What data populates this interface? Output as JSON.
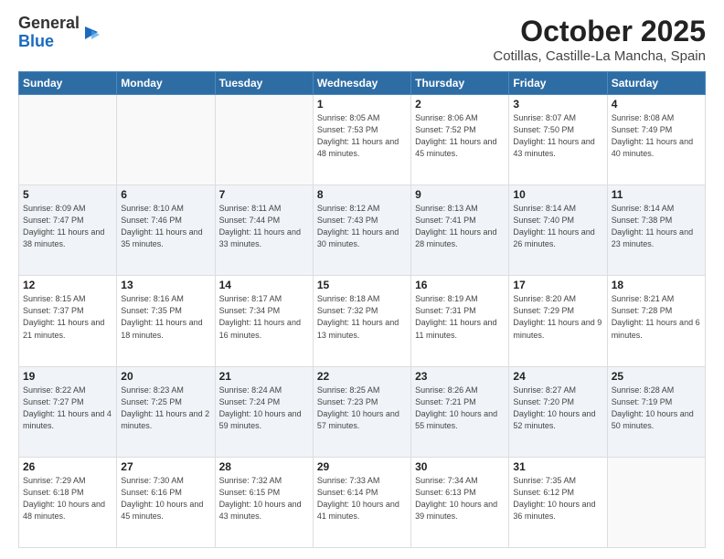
{
  "logo": {
    "general": "General",
    "blue": "Blue"
  },
  "title": "October 2025",
  "subtitle": "Cotillas, Castille-La Mancha, Spain",
  "days_of_week": [
    "Sunday",
    "Monday",
    "Tuesday",
    "Wednesday",
    "Thursday",
    "Friday",
    "Saturday"
  ],
  "weeks": [
    [
      {
        "day": "",
        "info": ""
      },
      {
        "day": "",
        "info": ""
      },
      {
        "day": "",
        "info": ""
      },
      {
        "day": "1",
        "info": "Sunrise: 8:05 AM\nSunset: 7:53 PM\nDaylight: 11 hours and 48 minutes."
      },
      {
        "day": "2",
        "info": "Sunrise: 8:06 AM\nSunset: 7:52 PM\nDaylight: 11 hours and 45 minutes."
      },
      {
        "day": "3",
        "info": "Sunrise: 8:07 AM\nSunset: 7:50 PM\nDaylight: 11 hours and 43 minutes."
      },
      {
        "day": "4",
        "info": "Sunrise: 8:08 AM\nSunset: 7:49 PM\nDaylight: 11 hours and 40 minutes."
      }
    ],
    [
      {
        "day": "5",
        "info": "Sunrise: 8:09 AM\nSunset: 7:47 PM\nDaylight: 11 hours and 38 minutes."
      },
      {
        "day": "6",
        "info": "Sunrise: 8:10 AM\nSunset: 7:46 PM\nDaylight: 11 hours and 35 minutes."
      },
      {
        "day": "7",
        "info": "Sunrise: 8:11 AM\nSunset: 7:44 PM\nDaylight: 11 hours and 33 minutes."
      },
      {
        "day": "8",
        "info": "Sunrise: 8:12 AM\nSunset: 7:43 PM\nDaylight: 11 hours and 30 minutes."
      },
      {
        "day": "9",
        "info": "Sunrise: 8:13 AM\nSunset: 7:41 PM\nDaylight: 11 hours and 28 minutes."
      },
      {
        "day": "10",
        "info": "Sunrise: 8:14 AM\nSunset: 7:40 PM\nDaylight: 11 hours and 26 minutes."
      },
      {
        "day": "11",
        "info": "Sunrise: 8:14 AM\nSunset: 7:38 PM\nDaylight: 11 hours and 23 minutes."
      }
    ],
    [
      {
        "day": "12",
        "info": "Sunrise: 8:15 AM\nSunset: 7:37 PM\nDaylight: 11 hours and 21 minutes."
      },
      {
        "day": "13",
        "info": "Sunrise: 8:16 AM\nSunset: 7:35 PM\nDaylight: 11 hours and 18 minutes."
      },
      {
        "day": "14",
        "info": "Sunrise: 8:17 AM\nSunset: 7:34 PM\nDaylight: 11 hours and 16 minutes."
      },
      {
        "day": "15",
        "info": "Sunrise: 8:18 AM\nSunset: 7:32 PM\nDaylight: 11 hours and 13 minutes."
      },
      {
        "day": "16",
        "info": "Sunrise: 8:19 AM\nSunset: 7:31 PM\nDaylight: 11 hours and 11 minutes."
      },
      {
        "day": "17",
        "info": "Sunrise: 8:20 AM\nSunset: 7:29 PM\nDaylight: 11 hours and 9 minutes."
      },
      {
        "day": "18",
        "info": "Sunrise: 8:21 AM\nSunset: 7:28 PM\nDaylight: 11 hours and 6 minutes."
      }
    ],
    [
      {
        "day": "19",
        "info": "Sunrise: 8:22 AM\nSunset: 7:27 PM\nDaylight: 11 hours and 4 minutes."
      },
      {
        "day": "20",
        "info": "Sunrise: 8:23 AM\nSunset: 7:25 PM\nDaylight: 11 hours and 2 minutes."
      },
      {
        "day": "21",
        "info": "Sunrise: 8:24 AM\nSunset: 7:24 PM\nDaylight: 10 hours and 59 minutes."
      },
      {
        "day": "22",
        "info": "Sunrise: 8:25 AM\nSunset: 7:23 PM\nDaylight: 10 hours and 57 minutes."
      },
      {
        "day": "23",
        "info": "Sunrise: 8:26 AM\nSunset: 7:21 PM\nDaylight: 10 hours and 55 minutes."
      },
      {
        "day": "24",
        "info": "Sunrise: 8:27 AM\nSunset: 7:20 PM\nDaylight: 10 hours and 52 minutes."
      },
      {
        "day": "25",
        "info": "Sunrise: 8:28 AM\nSunset: 7:19 PM\nDaylight: 10 hours and 50 minutes."
      }
    ],
    [
      {
        "day": "26",
        "info": "Sunrise: 7:29 AM\nSunset: 6:18 PM\nDaylight: 10 hours and 48 minutes."
      },
      {
        "day": "27",
        "info": "Sunrise: 7:30 AM\nSunset: 6:16 PM\nDaylight: 10 hours and 45 minutes."
      },
      {
        "day": "28",
        "info": "Sunrise: 7:32 AM\nSunset: 6:15 PM\nDaylight: 10 hours and 43 minutes."
      },
      {
        "day": "29",
        "info": "Sunrise: 7:33 AM\nSunset: 6:14 PM\nDaylight: 10 hours and 41 minutes."
      },
      {
        "day": "30",
        "info": "Sunrise: 7:34 AM\nSunset: 6:13 PM\nDaylight: 10 hours and 39 minutes."
      },
      {
        "day": "31",
        "info": "Sunrise: 7:35 AM\nSunset: 6:12 PM\nDaylight: 10 hours and 36 minutes."
      },
      {
        "day": "",
        "info": ""
      }
    ]
  ]
}
